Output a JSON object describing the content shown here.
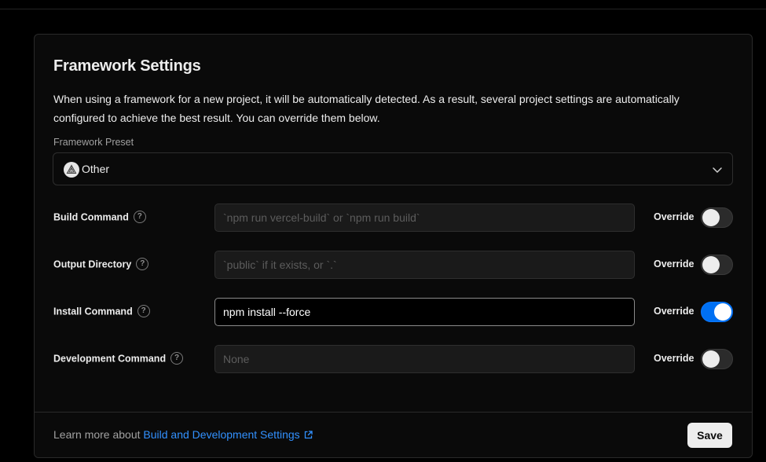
{
  "framework_settings": {
    "title": "Framework Settings",
    "description": "When using a framework for a new project, it will be automatically detected. As a result, several project settings are automatically configured to achieve the best result. You can override them below.",
    "preset": {
      "label": "Framework Preset",
      "value": "Other",
      "icon": "triangle-logo-icon"
    },
    "rows": [
      {
        "label": "Build Command",
        "value": "",
        "placeholder": "`npm run vercel-build` or `npm run build`",
        "override_label": "Override",
        "override": false
      },
      {
        "label": "Output Directory",
        "value": "",
        "placeholder": "`public` if it exists, or `.`",
        "override_label": "Override",
        "override": false
      },
      {
        "label": "Install Command",
        "value": "npm install --force",
        "placeholder": "",
        "override_label": "Override",
        "override": true
      },
      {
        "label": "Development Command",
        "value": "",
        "placeholder": "None",
        "override_label": "Override",
        "override": false
      }
    ],
    "help_glyph": "?",
    "footer": {
      "text_prefix": "Learn more about ",
      "link_text": "Build and Development Settings",
      "save_label": "Save"
    }
  },
  "colors": {
    "background": "#000000",
    "card": "#0a0a0a",
    "accent": "#0070f3",
    "link": "#3291ff"
  }
}
